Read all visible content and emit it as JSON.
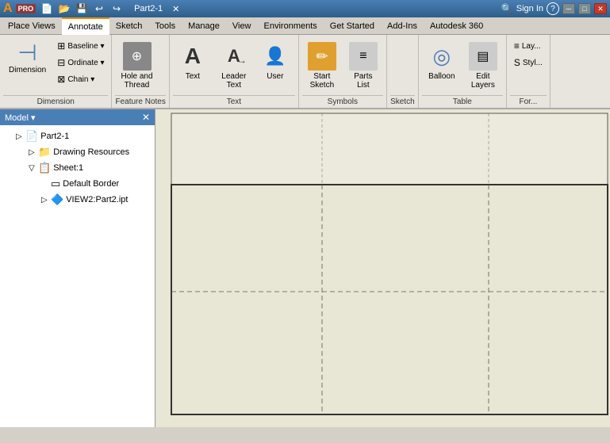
{
  "titlebar": {
    "title": "Part2-1",
    "tabs": [
      "Part2-1"
    ],
    "btn_min": "─",
    "btn_max": "□",
    "btn_close": "✕",
    "sign_in": "Sign In",
    "help": "?"
  },
  "menubar": {
    "items": [
      "Place Views",
      "Annotate",
      "Sketch",
      "Tools",
      "Manage",
      "View",
      "Environments",
      "Get Started",
      "Add-Ins",
      "Autodesk 360"
    ],
    "active": "Annotate"
  },
  "toolbar": {
    "back": "◀",
    "forward": "▶",
    "save": "💾",
    "undo": "↩",
    "redo": "↪"
  },
  "ribbon": {
    "groups": [
      {
        "id": "dimension",
        "label": "Dimension",
        "buttons_large": [
          {
            "id": "dimension",
            "icon": "⊣",
            "label": "Dimension"
          }
        ],
        "buttons_small": [
          {
            "id": "baseline",
            "icon": "⊞",
            "label": "Baseline ▾"
          },
          {
            "id": "ordinate",
            "icon": "⊟",
            "label": "Ordinate ▾"
          },
          {
            "id": "chain",
            "icon": "⊠",
            "label": "Chain ▾"
          }
        ]
      },
      {
        "id": "feature-notes",
        "label": "Feature Notes",
        "buttons": [
          {
            "id": "hole-thread",
            "icon": "⊕",
            "label": "Hole and\nThread"
          },
          {
            "id": "text",
            "icon": "A",
            "label": "Text"
          },
          {
            "id": "leader-text",
            "icon": "A→",
            "label": "Leader\nText"
          }
        ]
      },
      {
        "id": "text-group",
        "label": "Text",
        "buttons": [
          {
            "id": "user",
            "icon": "👤",
            "label": "User"
          }
        ]
      },
      {
        "id": "symbols",
        "label": "Symbols",
        "buttons": [
          {
            "id": "start-sketch",
            "icon": "✏",
            "label": "Start\nSketch"
          },
          {
            "id": "parts-list",
            "icon": "≡",
            "label": "Parts\nList"
          }
        ]
      },
      {
        "id": "sketch",
        "label": "Sketch",
        "buttons": []
      },
      {
        "id": "table",
        "label": "Table",
        "buttons": [
          {
            "id": "balloon",
            "icon": "◎",
            "label": "Balloon"
          },
          {
            "id": "edit-layers",
            "icon": "▤",
            "label": "Edit\nLayers"
          }
        ]
      },
      {
        "id": "format",
        "label": "For...",
        "buttons": [
          {
            "id": "layers",
            "icon": "≡",
            "label": "Lay..."
          },
          {
            "id": "styles",
            "icon": "S",
            "label": "Styl..."
          }
        ]
      }
    ]
  },
  "sidebar": {
    "title": "Model ▾",
    "close_label": "✕",
    "tree": [
      {
        "id": "part2-1",
        "label": "Part2-1",
        "indent": 0,
        "expand": "▷",
        "icon": "📄"
      },
      {
        "id": "drawing-resources",
        "label": "Drawing Resources",
        "indent": 1,
        "expand": "▷",
        "icon": "📁"
      },
      {
        "id": "sheet1",
        "label": "Sheet:1",
        "indent": 1,
        "expand": "▽",
        "icon": "📋"
      },
      {
        "id": "default-border",
        "label": "Default Border",
        "indent": 2,
        "expand": " ",
        "icon": "▭"
      },
      {
        "id": "view2",
        "label": "VIEW2:Part2.ipt",
        "indent": 2,
        "expand": "▷",
        "icon": "🔷"
      }
    ]
  },
  "canvas": {
    "background": "#e8e6d4"
  },
  "pro_label": "PRO"
}
